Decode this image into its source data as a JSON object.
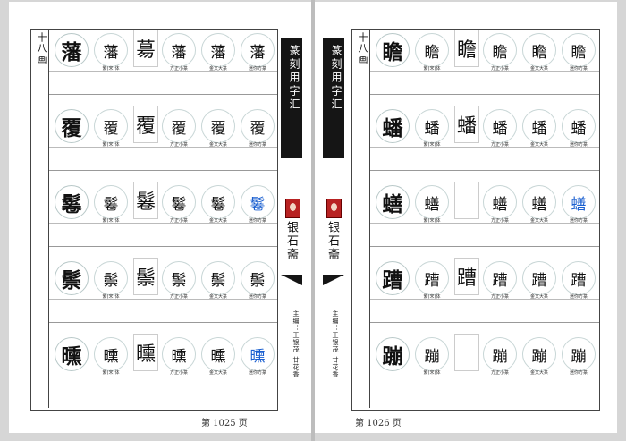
{
  "left_page": {
    "side_label": "十八画",
    "page_number": "第 1025 页",
    "banner_title": "篆刻用字汇",
    "publisher": "银石斋",
    "editors": "主编：王银茂 甘花香",
    "rows": [
      {
        "char": "藩",
        "cells": [
          "藩",
          "𦳝",
          "藩",
          "藩",
          "藩"
        ],
        "captions": [
          "繁(宋)体",
          "",
          "方正小篆",
          "金文大篆",
          "迷你方篆"
        ]
      },
      {
        "char": "覆",
        "cells": [
          "覆",
          "覆",
          "覆",
          "覆",
          "覆"
        ],
        "captions": [
          "繁(宋)体",
          "",
          "方正小篆",
          "金文大篆",
          "迷你方篆"
        ]
      },
      {
        "char": "鬈",
        "cells": [
          "鬈",
          "鬈",
          "鬈",
          "鬈",
          "鬈"
        ],
        "captions": [
          "繁(宋)体",
          "",
          "方正小篆",
          "金文大篆",
          "迷你方篆"
        ]
      },
      {
        "char": "鬃",
        "cells": [
          "鬃",
          "鬃",
          "鬃",
          "鬃",
          "鬃"
        ],
        "captions": [
          "繁(宋)体",
          "",
          "方正小篆",
          "金文大篆",
          "迷你方篆"
        ]
      },
      {
        "char": "曛",
        "cells": [
          "曛",
          "曛",
          "曛",
          "曛",
          "曛"
        ],
        "captions": [
          "繁(宋)体",
          "",
          "方正小篆",
          "金文大篆",
          "迷你方篆"
        ]
      }
    ]
  },
  "right_page": {
    "side_label": "十八画",
    "page_number": "第 1026 页",
    "banner_title": "篆刻用字汇",
    "publisher": "银石斋",
    "editors": "主编：王银茂 甘花香",
    "rows": [
      {
        "char": "瞻",
        "cells": [
          "瞻",
          "瞻",
          "瞻",
          "瞻",
          "瞻"
        ],
        "captions": [
          "繁(宋)体",
          "",
          "方正小篆",
          "金文大篆",
          "迷你方篆"
        ]
      },
      {
        "char": "蟠",
        "cells": [
          "蟠",
          "蟠",
          "蟠",
          "蟠",
          "蟠"
        ],
        "captions": [
          "繁(宋)体",
          "",
          "方正小篆",
          "金文大篆",
          "迷你方篆"
        ]
      },
      {
        "char": "蟮",
        "cells": [
          "蟮",
          "",
          "蟮",
          "蟮",
          "蟮"
        ],
        "captions": [
          "繁(宋)体",
          "",
          "方正小篆",
          "金文大篆",
          "迷你方篆"
        ]
      },
      {
        "char": "蹧",
        "cells": [
          "蹧",
          "蹧",
          "蹧",
          "蹧",
          "蹧"
        ],
        "captions": [
          "繁(宋)体",
          "",
          "方正小篆",
          "金文大篆",
          "迷你方篆"
        ]
      },
      {
        "char": "蹦",
        "cells": [
          "蹦",
          "",
          "蹦",
          "蹦",
          "蹦"
        ],
        "captions": [
          "繁(宋)体",
          "",
          "方正小篆",
          "金文大篆",
          "迷你方篆"
        ]
      }
    ]
  }
}
